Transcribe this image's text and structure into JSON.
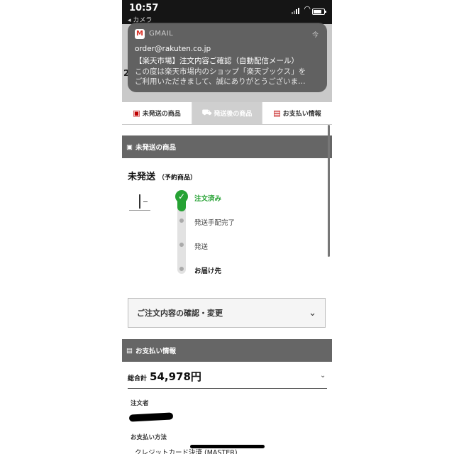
{
  "status_bar": {
    "time": "10:57",
    "back_label": "◂ カメラ"
  },
  "page_behind": {
    "edge_text": "2"
  },
  "notification": {
    "app_name": "GMAIL",
    "time": "今",
    "sender": "order@rakuten.co.jp",
    "subject": "【楽天市場】注文内容ご確認（自動配信メール）",
    "body_line1": "この度は楽天市場内のショップ「楽天ブックス」を",
    "body_line2": "ご利用いただきまして、誠にありがとうございま…"
  },
  "tabs": [
    {
      "label": "未発送の商品",
      "icon": "box-icon"
    },
    {
      "label": "発送後の商品",
      "icon": "truck-icon"
    },
    {
      "label": "お支払い情報",
      "icon": "wallet-icon"
    }
  ],
  "unshipped_section": {
    "header": "未発送の商品",
    "status": "未発送",
    "status_note": "（予約商品）",
    "steps": [
      "注文済み",
      "発送手配完了",
      "発送",
      "お届け先"
    ]
  },
  "confirm_change": {
    "label": "ご注文内容の確認・変更"
  },
  "payment_section": {
    "header": "お支払い情報",
    "total_label": "総合計",
    "total_value": "54,978円",
    "orderer_label": "注文者",
    "payment_method_label": "お支払い方法",
    "payment_method_value": "クレジットカード決済 (MASTER)"
  },
  "colors": {
    "accent_red": "#bf0000",
    "progress_green": "#26a234",
    "section_gray": "#666666"
  }
}
